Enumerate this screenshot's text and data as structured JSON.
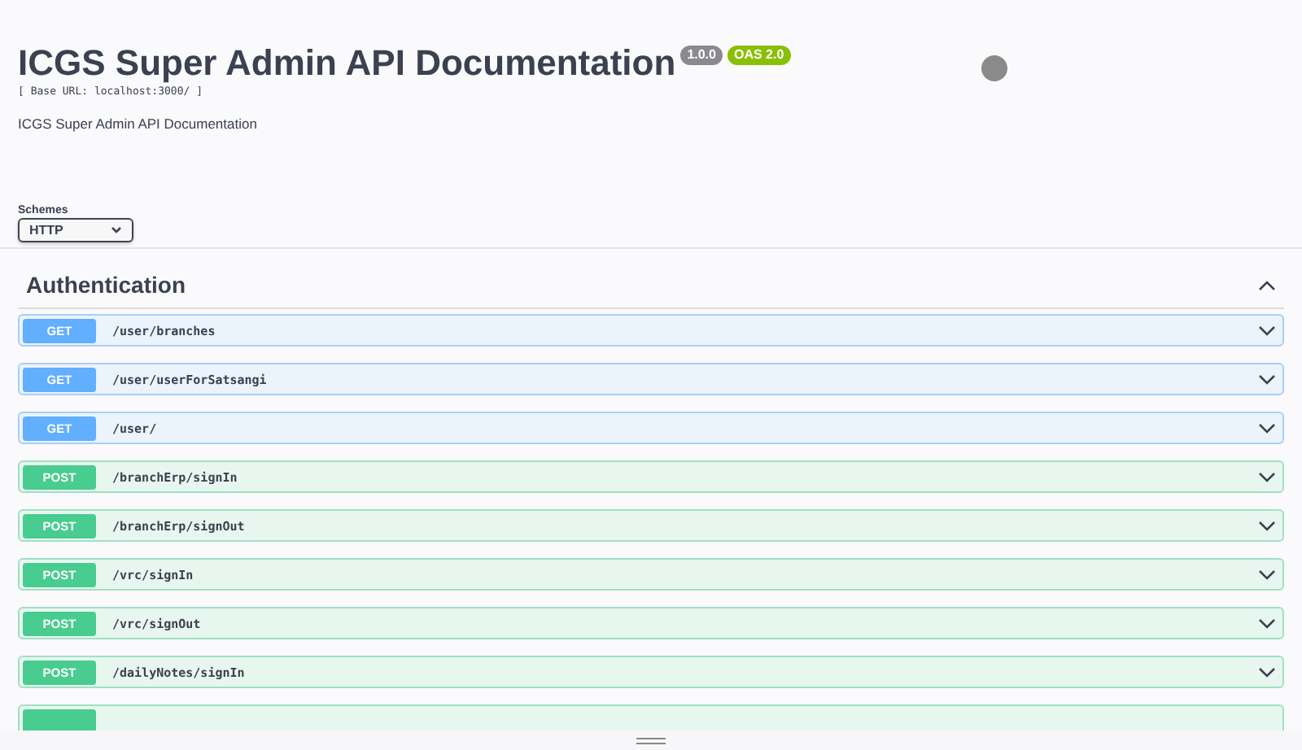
{
  "info": {
    "title": "ICGS Super Admin API Documentation",
    "version": "1.0.0",
    "oas": "OAS 2.0",
    "base_url": "[ Base URL: localhost:3000/ ]",
    "description": "ICGS Super Admin API Documentation"
  },
  "schemes": {
    "label": "Schemes",
    "value": "HTTP"
  },
  "section": {
    "title": "Authentication",
    "expanded": true
  },
  "operations": [
    {
      "method": "GET",
      "path": "/user/branches"
    },
    {
      "method": "GET",
      "path": "/user/userForSatsangi"
    },
    {
      "method": "GET",
      "path": "/user/"
    },
    {
      "method": "POST",
      "path": "/branchErp/signIn"
    },
    {
      "method": "POST",
      "path": "/branchErp/signOut"
    },
    {
      "method": "POST",
      "path": "/vrc/signIn"
    },
    {
      "method": "POST",
      "path": "/vrc/signOut"
    },
    {
      "method": "POST",
      "path": "/dailyNotes/signIn"
    },
    {
      "color": "#49cc90"
    }
  ]
}
